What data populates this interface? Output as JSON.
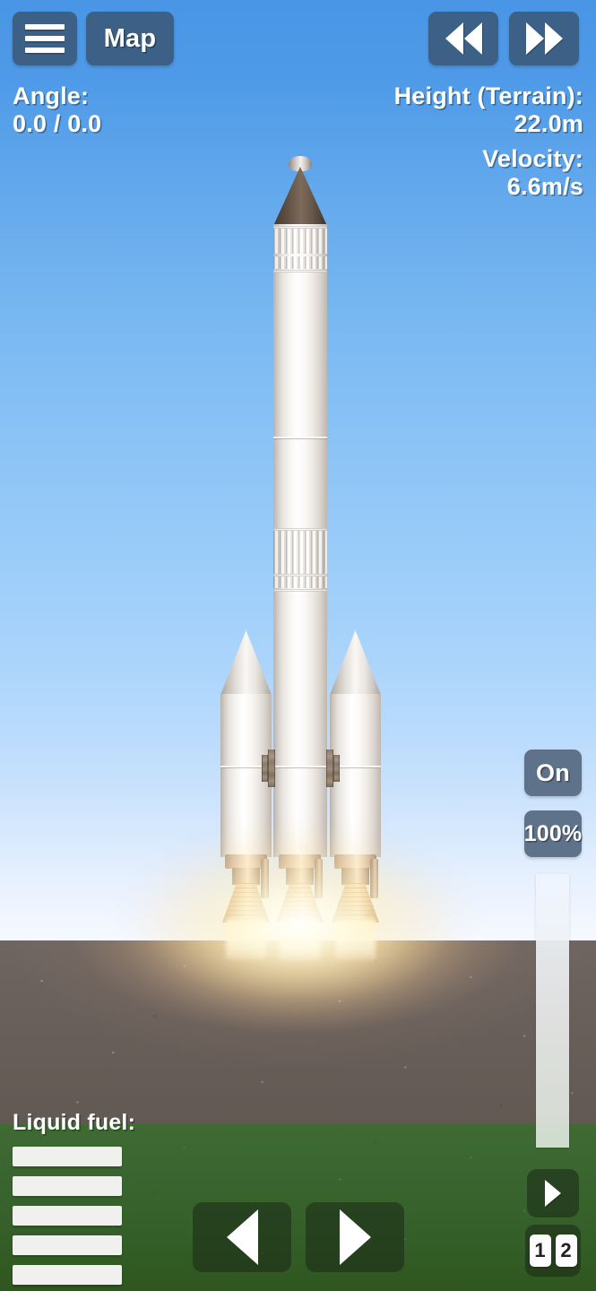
{
  "topbar": {
    "menu_icon": "hamburger-menu-icon",
    "map_label": "Map",
    "rewind_icon": "rewind-icon",
    "fastforward_icon": "fast-forward-icon"
  },
  "readouts": {
    "angle_label": "Angle:",
    "angle_value": "0.0 / 0.0",
    "height_label": "Height (Terrain):",
    "height_value": "22.0m",
    "velocity_label": "Velocity:",
    "velocity_value": "6.6m/s"
  },
  "engine_controls": {
    "power_label": "On",
    "throttle_label": "100%",
    "throttle_percent": 100
  },
  "fuel": {
    "title": "Liquid fuel:",
    "bars": [
      100,
      100,
      100,
      100,
      100
    ]
  },
  "stage_controls": {
    "stage_icon": "play-triangle-icon",
    "chips": [
      "1",
      "2"
    ]
  },
  "rotation": {
    "left_icon": "rotate-left-icon",
    "right_icon": "rotate-right-icon"
  },
  "colors": {
    "sky_top": "#4996e6",
    "sky_bottom": "#f6f9ff",
    "ground": "#6a605b",
    "grass": "#3a6530",
    "button_blue": "#3d6186",
    "button_slate": "#5e7289",
    "button_dark": "#1a2816",
    "text": "#ffffff",
    "nose_cone": "#6e5d4f",
    "flame": "#fff6d8"
  },
  "scene": {
    "rocket_parts": [
      "nose-cone",
      "fuel-tank",
      "side-booster-left",
      "side-booster-right",
      "engine-center",
      "engine-left",
      "engine-right",
      "decoupler-left",
      "decoupler-right"
    ],
    "engines_firing": 3
  }
}
